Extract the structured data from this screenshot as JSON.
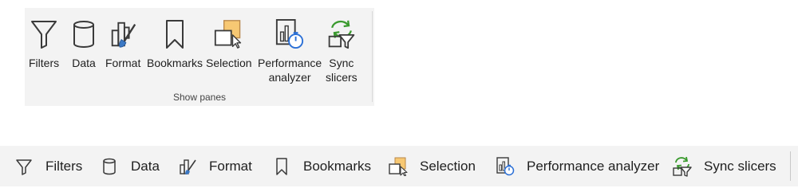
{
  "show_panes": {
    "group_label": "Show panes",
    "buttons": [
      {
        "icon": "filter-icon",
        "label": "Filters"
      },
      {
        "icon": "data-icon",
        "label": "Data"
      },
      {
        "icon": "format-brush-icon",
        "label": "Format"
      },
      {
        "icon": "bookmark-icon",
        "label": "Bookmarks"
      },
      {
        "icon": "selection-icon",
        "label": "Selection"
      },
      {
        "icon": "performance-analyzer-icon",
        "label": "Performance",
        "label2": "analyzer"
      },
      {
        "icon": "sync-slicers-icon",
        "label": "Sync",
        "label2": "slicers"
      }
    ]
  },
  "simplified_bar": {
    "buttons": [
      {
        "icon": "filter-icon",
        "label": "Filters"
      },
      {
        "icon": "data-icon",
        "label": "Data"
      },
      {
        "icon": "format-brush-icon",
        "label": "Format"
      },
      {
        "icon": "bookmark-icon",
        "label": "Bookmarks"
      },
      {
        "icon": "selection-icon",
        "label": "Selection"
      },
      {
        "icon": "performance-analyzer-icon",
        "label": "Performance analyzer"
      },
      {
        "icon": "sync-slicers-icon",
        "label": "Sync slicers"
      }
    ]
  },
  "colors": {
    "ribbon_bg": "#f3f3f3",
    "selection_accent": "#f7c873",
    "stopwatch_blue": "#2a6fd6",
    "sync_green": "#3a9a2e",
    "brush_blue": "#3b78c4"
  }
}
